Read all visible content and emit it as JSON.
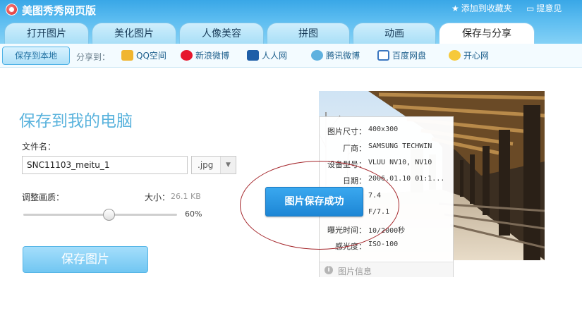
{
  "app": {
    "title": "美图秀秀网页版"
  },
  "header_links": {
    "favorite": "添加到收藏夹",
    "feedback": "提意见"
  },
  "tabs": [
    "打开图片",
    "美化图片",
    "人像美容",
    "拼图",
    "动画",
    "保存与分享"
  ],
  "active_tab": "保存与分享",
  "share_bar": {
    "save_local": "保存到本地",
    "share_to": "分享到：",
    "targets": [
      "QQ空间",
      "新浪微博",
      "人人网",
      "腾讯微博",
      "百度网盘",
      "开心网"
    ]
  },
  "save_panel": {
    "title": "保存到我的电脑",
    "filename_label": "文件名：",
    "filename_value": "SNC11103_meitu_1",
    "extension": ".jpg",
    "quality_label": "调整画质：",
    "size_label": "大小：",
    "size_value": "26.1 KB",
    "quality_percent": "60%",
    "quality_fraction": 0.6,
    "save_button": "保存图片"
  },
  "image_info": {
    "rows": [
      {
        "key": "图片尺寸：",
        "value": "400x300"
      },
      {
        "key": "厂商：",
        "value": "SAMSUNG TECHWIN"
      },
      {
        "key": "设备型号：",
        "value": "VLUU NV10, NV10"
      },
      {
        "key": "日期：",
        "value": "2006.01.10  01:1..."
      },
      {
        "key": "",
        "value": "7.4"
      },
      {
        "key": "",
        "value": "F/7.1"
      },
      {
        "key": "曝光时间：",
        "value": "10/2000秒"
      },
      {
        "key": "感光度：",
        "value": "ISO-100"
      }
    ],
    "footer_label": "图片信息"
  },
  "toast": {
    "text": "图片保存成功"
  },
  "colors": {
    "header_blue": "#39a7e7",
    "title_blue": "#5ab3dd",
    "toast_blue": "#2596e2",
    "annotation_red": "#a4252a"
  }
}
